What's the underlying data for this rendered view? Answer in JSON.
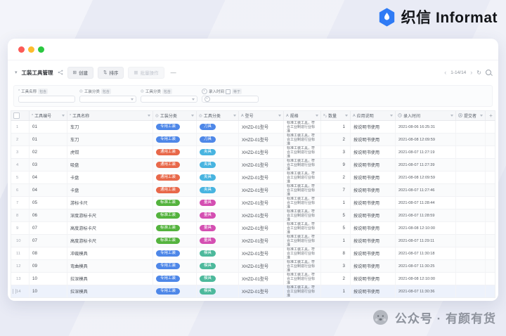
{
  "brand": {
    "name": "织信 Informat",
    "icon": "hexagon-drop-logo"
  },
  "window": {
    "toolbar": {
      "title": "工装工具管理",
      "create_label": "创建",
      "sort_label": "排序",
      "batch_label": "批量操作",
      "pagination": "1-14/14"
    },
    "filters": [
      {
        "label": "工具名称",
        "operator": "包含",
        "type": "text"
      },
      {
        "label": "工装分类",
        "operator": "包含",
        "type": "select"
      },
      {
        "label": "工具分类",
        "operator": "包含",
        "type": "select"
      },
      {
        "label": "录入时间",
        "operator": "等于",
        "type": "date"
      }
    ],
    "table": {
      "columns": [
        {
          "key": "code",
          "label": "工具编号",
          "icon": "asterisk-field-icon"
        },
        {
          "key": "name",
          "label": "工具名称",
          "icon": "asterisk-field-icon"
        },
        {
          "key": "category",
          "label": "工装分类",
          "icon": "select-field-icon"
        },
        {
          "key": "type",
          "label": "工具分类",
          "icon": "select-field-icon"
        },
        {
          "key": "model",
          "label": "型号",
          "icon": "text-field-icon"
        },
        {
          "key": "spec",
          "label": "规格",
          "icon": "text-field-icon"
        },
        {
          "key": "qty",
          "label": "数量",
          "icon": "number-field-icon"
        },
        {
          "key": "usage",
          "label": "应用说明",
          "icon": "text-field-icon"
        },
        {
          "key": "time",
          "label": "录入时间",
          "icon": "time-field-icon"
        },
        {
          "key": "submitter",
          "label": "提交者",
          "icon": "person-icon"
        }
      ],
      "badge_colors": {
        "专用工装": "#4e87e8",
        "通用工装": "#e8684a",
        "标准工装": "#54b33e",
        "刀具": "#4e87e8",
        "夹具": "#48b4e0",
        "量具": "#d44fb2",
        "模具": "#4db99c"
      },
      "rows": [
        {
          "index": 1,
          "code": "01",
          "name": "车刀",
          "category": "专用工装",
          "type": "刀具",
          "model": "XHZD-01型号",
          "spec": "标准工装工具，符合工业制造行业标准",
          "qty": 1,
          "usage": "按说明书使用",
          "time": "2021-08-06 16:25:31",
          "submitter": ""
        },
        {
          "index": 2,
          "code": "01",
          "name": "车刀",
          "category": "专用工装",
          "type": "刀具",
          "model": "XHZD-01型号",
          "spec": "标准工装工具，符合工业制造行业标准",
          "qty": 2,
          "usage": "按说明书使用",
          "time": "2021-08-08 12:09:59",
          "submitter": ""
        },
        {
          "index": 3,
          "code": "02",
          "name": "虎钳",
          "category": "通用工装",
          "type": "夹具",
          "model": "XHZD-01型号",
          "spec": "标准工装工具，符合工业制造行业标准",
          "qty": 3,
          "usage": "按说明书使用",
          "time": "2021-08-07 11:27:19",
          "submitter": ""
        },
        {
          "index": 4,
          "code": "03",
          "name": "吸盘",
          "category": "通用工装",
          "type": "夹具",
          "model": "XHZD-01型号",
          "spec": "标准工装工具，符合工业制造行业标准",
          "qty": 9,
          "usage": "按说明书使用",
          "time": "2021-08-07 11:27:39",
          "submitter": ""
        },
        {
          "index": 5,
          "code": "04",
          "name": "卡盘",
          "category": "通用工装",
          "type": "夹具",
          "model": "XHZD-01型号",
          "spec": "标准工装工具，符合工业制造行业标准",
          "qty": 2,
          "usage": "按说明书使用",
          "time": "2021-08-08 12:09:59",
          "submitter": ""
        },
        {
          "index": 6,
          "code": "04",
          "name": "卡盘",
          "category": "通用工装",
          "type": "夹具",
          "model": "XHZD-01型号",
          "spec": "标准工装工具，符合工业制造行业标准",
          "qty": 7,
          "usage": "按说明书使用",
          "time": "2021-08-07 11:27:46",
          "submitter": ""
        },
        {
          "index": 7,
          "code": "05",
          "name": "游标卡尺",
          "category": "标准工装",
          "type": "量具",
          "model": "XHZD-01型号",
          "spec": "标准工装工具，符合工业制造行业标准",
          "qty": 1,
          "usage": "按说明书使用",
          "time": "2021-08-07 11:28:44",
          "submitter": ""
        },
        {
          "index": 8,
          "code": "06",
          "name": "深度游标卡尺",
          "category": "标准工装",
          "type": "量具",
          "model": "XHZD-01型号",
          "spec": "标准工装工具，符合工业制造行业标准",
          "qty": 5,
          "usage": "按说明书使用",
          "time": "2021-08-07 11:28:59",
          "submitter": ""
        },
        {
          "index": 9,
          "code": "07",
          "name": "高度游标卡尺",
          "category": "标准工装",
          "type": "量具",
          "model": "XHZD-01型号",
          "spec": "标准工装工具，符合工业制造行业标准",
          "qty": 5,
          "usage": "按说明书使用",
          "time": "2021-08-08 12:10:00",
          "submitter": ""
        },
        {
          "index": 10,
          "code": "07",
          "name": "高度游标卡尺",
          "category": "标准工装",
          "type": "量具",
          "model": "XHZD-01型号",
          "spec": "标准工装工具，符合工业制造行业标准",
          "qty": 1,
          "usage": "按说明书使用",
          "time": "2021-08-07 11:29:11",
          "submitter": ""
        },
        {
          "index": 11,
          "code": "08",
          "name": "冲裁模具",
          "category": "专用工装",
          "type": "模具",
          "model": "XHZD-01型号",
          "spec": "标准工装工具，符合工业制造行业标准",
          "qty": 8,
          "usage": "按说明书使用",
          "time": "2021-08-07 11:30:18",
          "submitter": ""
        },
        {
          "index": 12,
          "code": "09",
          "name": "弯曲模具",
          "category": "专用工装",
          "type": "模具",
          "model": "XHZD-01型号",
          "spec": "标准工装工具，符合工业制造行业标准",
          "qty": 3,
          "usage": "按说明书使用",
          "time": "2021-08-07 11:30:25",
          "submitter": ""
        },
        {
          "index": 13,
          "code": "10",
          "name": "拉深模具",
          "category": "专用工装",
          "type": "模具",
          "model": "XHZD-01型号",
          "spec": "标准工装工具，符合工业制造行业标准",
          "qty": 2,
          "usage": "按说明书使用",
          "time": "2021-08-08 12:10:00",
          "submitter": ""
        },
        {
          "index": 14,
          "code": "10",
          "name": "拉深模具",
          "category": "专用工装",
          "type": "模具",
          "model": "XHZD-01型号",
          "spec": "标准工装工具，符合工业制造行业标准",
          "qty": 1,
          "usage": "按说明书使用",
          "time": "2021-08-07 11:30:36",
          "submitter": ""
        }
      ]
    }
  },
  "watermark": {
    "text": "公众号 · 有颜有货"
  },
  "icons": {
    "brand": "hexagon-drop",
    "create": "plus-square",
    "sort": "arrows-up-down",
    "batch": "grid",
    "title_share": "share",
    "pagination_prev": "chevron-left",
    "pagination_next": "chevron-right",
    "refresh": "refresh",
    "search": "magnifier",
    "time": "clock",
    "person": "person"
  }
}
